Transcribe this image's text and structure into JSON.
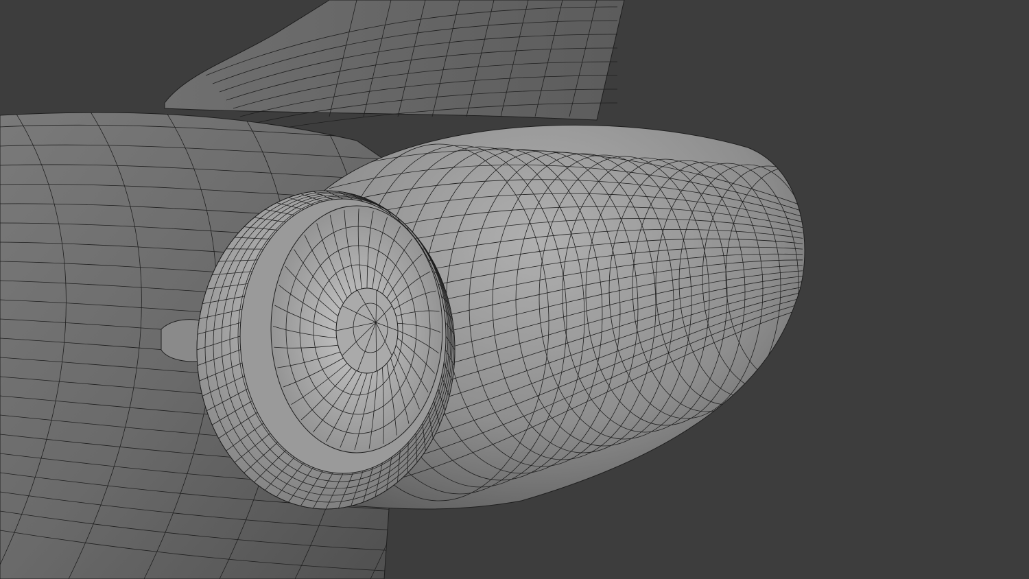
{
  "viewport": {
    "background_color": "#3d3d3d",
    "surface_color": "#8c8c8c",
    "wire_color": "#1e1e1e"
  },
  "model": {
    "fan_blade_count": 36,
    "ring_segments": 64
  }
}
